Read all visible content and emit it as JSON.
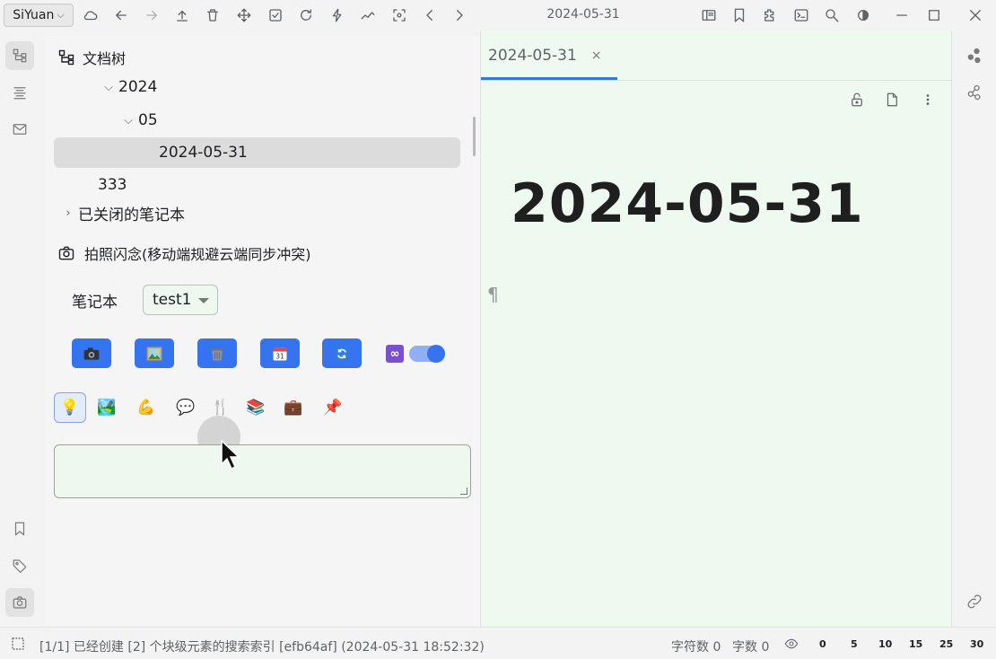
{
  "app": {
    "brand": "SiYuan",
    "title": "2024-05-31"
  },
  "toolbar": {
    "icons": [
      "cloud-icon",
      "back-icon",
      "forward-icon",
      "upload-icon",
      "trash-icon",
      "move-icon",
      "checkbox-icon",
      "refresh-icon",
      "lightning-icon",
      "graph-icon",
      "scan-icon",
      "chevron-left-icon",
      "chevron-right-icon"
    ],
    "right_icons": [
      "book-icon",
      "bookmark-icon",
      "plugin-icon",
      "terminal-icon",
      "search-icon",
      "theme-icon",
      "minimize-icon",
      "maximize-icon",
      "close-icon"
    ]
  },
  "sidebar": {
    "tree_title": "文档树",
    "tree": [
      {
        "label": "2024",
        "expanded": true,
        "level": 1
      },
      {
        "label": "05",
        "expanded": true,
        "level": 2
      },
      {
        "label": "2024-05-31",
        "selected": true,
        "level": 3
      },
      {
        "label": "333",
        "level": 0
      }
    ],
    "closed_notebooks": "已关闭的笔记本",
    "snapshot_title": "拍照闪念(移动端规避云端同步冲突)",
    "notebook_label": "笔记本",
    "notebook_value": "test1",
    "action_buttons": [
      "camera",
      "picture",
      "trash",
      "calendar",
      "sync"
    ],
    "toggle_on": true,
    "emojis": [
      "💡",
      "🏞️",
      "💪",
      "💬",
      "🍴",
      "📚",
      "💼",
      "📌"
    ],
    "selected_emoji_index": 0,
    "note_text": ""
  },
  "editor": {
    "tab_label": "2024-05-31",
    "tab_close": "×",
    "doc_title": "2024-05-31",
    "pilcrow": "¶"
  },
  "status": {
    "message": "[1/1] 已经创建 [2] 个块级元素的搜索索引 [efb64af] (2024-05-31 18:52:32)",
    "char_count": "字符数 0",
    "word_count": "字数 0",
    "zoom_marks": [
      "0",
      "5",
      "10",
      "15",
      "25",
      "30"
    ]
  }
}
